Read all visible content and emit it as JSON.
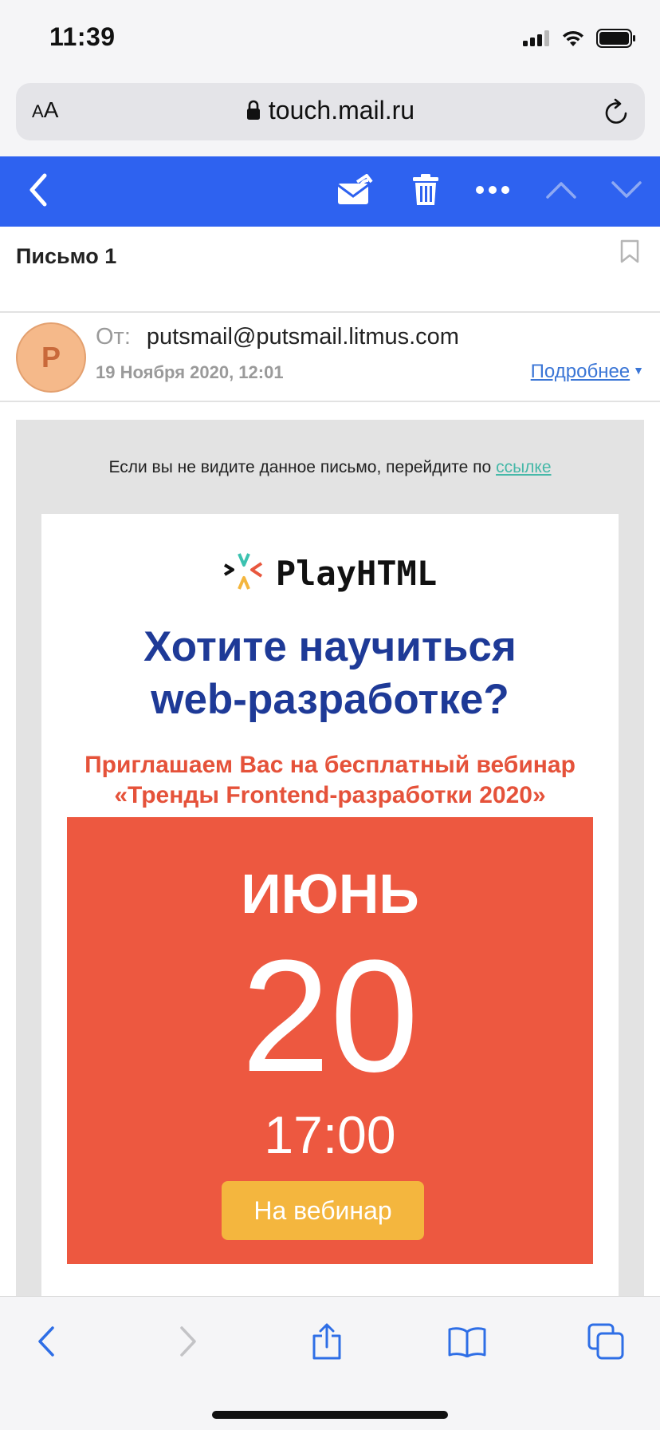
{
  "status_bar": {
    "time": "11:39"
  },
  "browser": {
    "text_size_small": "A",
    "text_size_large": "A",
    "url": "touch.mail.ru"
  },
  "toolbar": {
    "icons": [
      "back-icon",
      "move-icon",
      "trash-icon",
      "more-icon",
      "prev-message-icon",
      "next-message-icon"
    ],
    "accent_color": "#2e62f0"
  },
  "message": {
    "subject": "Письмо 1",
    "avatar_letter": "P",
    "from_label": "От:",
    "from_address": "putsmail@putsmail.litmus.com",
    "date": "19 Ноября 2020, 12:01",
    "details_link": "Подробнее"
  },
  "email_body": {
    "preheader_text": "Если вы не видите данное письмо, перейдите по",
    "preheader_link": "ссылке",
    "logo_text": "PlayHTML",
    "headline_line1": "Хотите научиться",
    "headline_line2": "web-разработке?",
    "subline_line1": "Приглашаем Вас на бесплатный вебинар",
    "subline_line2": "«Тренды Frontend-разработки 2020»",
    "event_month": "ИЮНЬ",
    "event_day": "20",
    "event_time": "17:00",
    "cta_label": "На вебинар",
    "colors": {
      "headline": "#1e3a97",
      "subline": "#e5523a",
      "box": "#ed5840",
      "cta": "#f4b63e"
    }
  },
  "bottom_bar": {
    "icons": [
      "back-icon",
      "forward-icon",
      "share-icon",
      "bookmarks-icon",
      "tabs-icon"
    ]
  }
}
